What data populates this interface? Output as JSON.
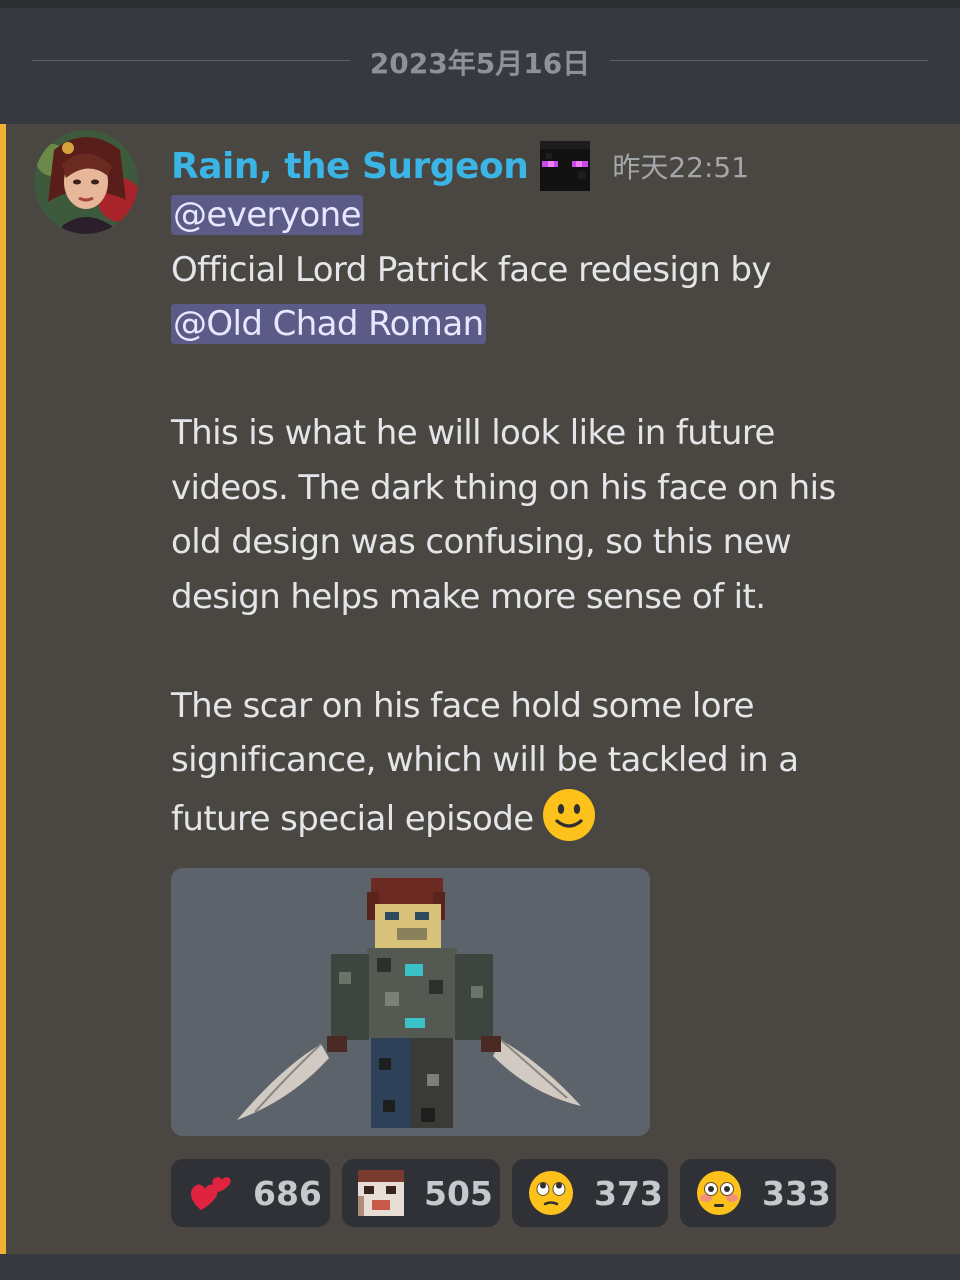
{
  "date_divider": {
    "label": "2023年5月16日"
  },
  "message": {
    "author": "Rain, the Surgeon",
    "timestamp": "昨天22:51",
    "mention_everyone": "@everyone",
    "line_intro": "Official Lord Patrick face redesign by",
    "mention_user": "@Old Chad Roman",
    "paragraph_1": "This is what he will look like in future\nvideos. The dark thing on his face on his\nold design was confusing, so this new\ndesign helps make more sense of it.",
    "paragraph_2": "The scar on his face hold some lore\nsignificance, which will be tackled in a\nfuture special episode",
    "colors": {
      "author": "#3ab5e6",
      "mention_bar": "#f0b232",
      "mention_bg": "#5c5a86"
    }
  },
  "reactions": [
    {
      "icon": "two-hearts-icon",
      "count": "686"
    },
    {
      "icon": "custom-face-emoji-icon",
      "count": "505"
    },
    {
      "icon": "rolling-eyes-face-icon",
      "count": "373"
    },
    {
      "icon": "flushed-face-icon",
      "count": "333"
    }
  ]
}
